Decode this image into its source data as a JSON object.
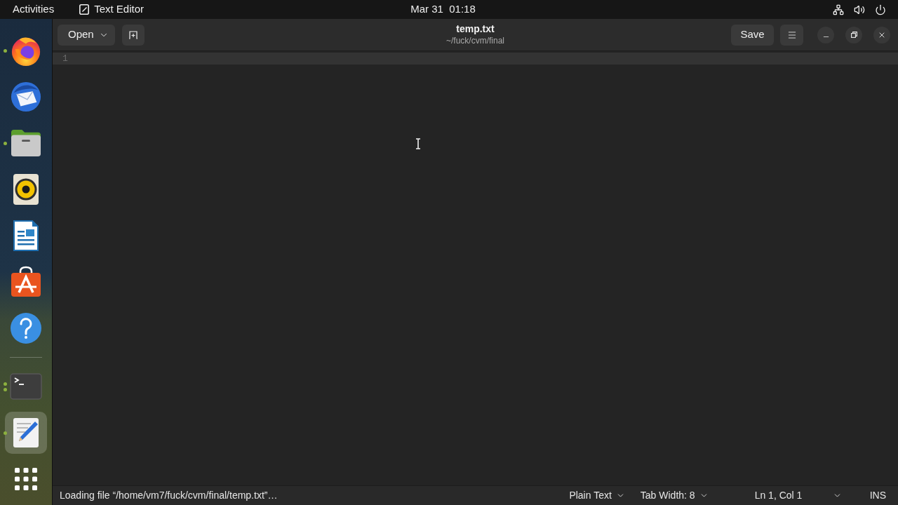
{
  "top_bar": {
    "activities": "Activities",
    "app_menu": "Text Editor",
    "clock": "Mar 31  01:18"
  },
  "dock": {
    "favorites": [
      {
        "kind": "browser",
        "running": true,
        "multiple_windows": false,
        "selected": false
      },
      {
        "kind": "mail",
        "running": false,
        "multiple_windows": false,
        "selected": false
      },
      {
        "kind": "files",
        "running": true,
        "multiple_windows": false,
        "selected": false
      },
      {
        "kind": "music",
        "running": false,
        "multiple_windows": false,
        "selected": false
      },
      {
        "kind": "writer",
        "running": false,
        "multiple_windows": false,
        "selected": false
      },
      {
        "kind": "store",
        "running": false,
        "multiple_windows": false,
        "selected": false
      },
      {
        "kind": "help",
        "running": false,
        "multiple_windows": false,
        "selected": false
      }
    ],
    "running_apps": [
      {
        "kind": "terminal",
        "running": true,
        "multiple_windows": true,
        "selected": false
      },
      {
        "kind": "editor",
        "running": true,
        "multiple_windows": false,
        "selected": true
      }
    ]
  },
  "header_bar": {
    "open_button": "Open",
    "title": "temp.txt",
    "subtitle": "~/fuck/cvm/final",
    "save_button": "Save"
  },
  "editor": {
    "lines": [
      {
        "number": "1",
        "current": true
      }
    ]
  },
  "status_bar": {
    "message": "Loading file “/home/vm7/fuck/cvm/final/temp.txt”…",
    "items": [
      {
        "kind": "dropdown",
        "label": "Plain Text"
      },
      {
        "kind": "dropdown",
        "label": "Tab Width: 8"
      },
      {
        "kind": "position",
        "label": "Ln 1, Col 1"
      },
      {
        "kind": "mode",
        "label": "INS"
      }
    ]
  }
}
